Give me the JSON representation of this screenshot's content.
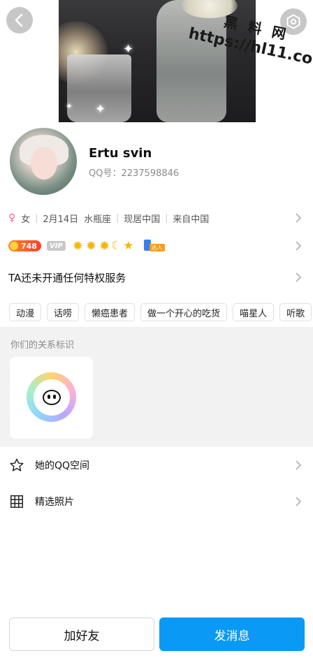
{
  "watermark": {
    "title": "黑 料 网",
    "url": "https://hl11.co"
  },
  "profile": {
    "nickname": "Ertu svin",
    "qq_label": "QQ号：2237598846"
  },
  "info": {
    "gender_icon": "female-icon",
    "gender": "女",
    "birthday": "2月14日",
    "zodiac": "水瓶座",
    "location": "现居中国",
    "hometown": "来自中国"
  },
  "badges": {
    "level": "748",
    "vip": "VIP",
    "extra_tag": "达人",
    "icons": [
      "sun-icon",
      "sun-icon",
      "sun-icon",
      "moon-icon",
      "star-icon"
    ]
  },
  "privilege": {
    "text": "TA还未开通任何特权服务"
  },
  "tags": [
    "动漫",
    "话唠",
    "懒癌患者",
    "做一个开心的吃货",
    "喵星人",
    "听歌"
  ],
  "relation": {
    "title": "你们的关系标识"
  },
  "menu": {
    "qzone": "她的QQ空间",
    "photos": "精选照片"
  },
  "actions": {
    "add_friend": "加好友",
    "send_message": "发消息"
  },
  "colors": {
    "accent": "#0a9af5",
    "gender": "#ff5c9a",
    "level_badge": "#ff5a24",
    "section_bg": "#f2f2f2"
  }
}
